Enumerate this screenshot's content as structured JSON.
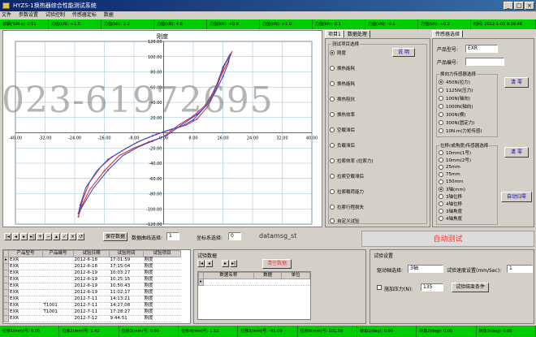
{
  "window": {
    "title": "HYZS-1换热器综合性能测试系统",
    "buttons": [
      "_",
      "□",
      "×"
    ]
  },
  "menu": [
    "文件",
    "参数设置",
    "试验控制",
    "传感器定标",
    "数据"
  ],
  "readings": [
    "日期(%M·s): 0.51",
    "力值(kN): +1.5",
    "力值(kN): 2.2",
    "力值(kN): 4.6",
    "力值(kN): +0.6",
    "力值(kN): +1.0",
    "力值(kN): 0.1",
    "力值(kN): -0.1",
    "力值(kN): +0.2",
    "时间: 2012-1-03 9:36:46"
  ],
  "chart": {
    "title": "刚度",
    "x_ticks": [
      "-40.00",
      "-32.00",
      "-24.00",
      "-16.00",
      "-8.00",
      "0.00",
      "8.00",
      "16.00",
      "24.00",
      "32.00",
      "40.00"
    ],
    "y_ticks": [
      "120.00",
      "100.00",
      "80.00",
      "60.00",
      "40.00",
      "20.00",
      "0.00",
      "-20.00",
      "-40.00",
      "-60.00",
      "-80.00",
      "-100.00",
      "-120.00"
    ]
  },
  "chart_data": {
    "type": "line",
    "title": "刚度",
    "xlim": [
      -40,
      40
    ],
    "ylim": [
      -120,
      120
    ],
    "grid": true,
    "series": [
      {
        "color": "#e03030",
        "points": [
          [
            -23.0,
            -110.0
          ],
          [
            -22.0,
            -95.0
          ],
          [
            -20.0,
            -75.0
          ],
          [
            -16.0,
            -50.0
          ],
          [
            -12.0,
            -30.0
          ],
          [
            -8.0,
            -20.0
          ],
          [
            -4.0,
            -12.0
          ],
          [
            0.0,
            -5.0
          ],
          [
            4.0,
            10.0
          ],
          [
            8.0,
            22.0
          ],
          [
            11.0,
            35.0
          ],
          [
            13.0,
            50.0
          ],
          [
            15.0,
            70.0
          ],
          [
            17.0,
            90.0
          ],
          [
            18.5,
            107.0
          ],
          [
            16.5,
            90.0
          ],
          [
            14.0,
            55.0
          ],
          [
            12.0,
            35.0
          ],
          [
            9.0,
            18.0
          ],
          [
            6.0,
            10.0
          ],
          [
            2.0,
            4.0
          ],
          [
            -2.0,
            -2.0
          ],
          [
            -6.0,
            -10.0
          ],
          [
            -10.0,
            -20.0
          ],
          [
            -14.0,
            -32.0
          ],
          [
            -17.0,
            -45.0
          ],
          [
            -20.0,
            -65.0
          ],
          [
            -22.0,
            -90.0
          ],
          [
            -23.0,
            -110.0
          ]
        ]
      },
      {
        "color": "#3050d0",
        "points": [
          [
            -23.0,
            -106.0
          ],
          [
            -21.5,
            -93.0
          ],
          [
            -19.0,
            -73.0
          ],
          [
            -15.0,
            -49.0
          ],
          [
            -11.0,
            -30.0
          ],
          [
            -7.0,
            -19.0
          ],
          [
            -3.0,
            -11.0
          ],
          [
            1.0,
            -3.0
          ],
          [
            5.0,
            11.0
          ],
          [
            9.0,
            24.0
          ],
          [
            12.0,
            38.0
          ],
          [
            14.0,
            54.0
          ],
          [
            16.0,
            74.0
          ],
          [
            17.5,
            92.0
          ],
          [
            18.0,
            104.0
          ],
          [
            16.0,
            86.0
          ],
          [
            13.5,
            52.0
          ],
          [
            11.0,
            33.0
          ],
          [
            8.0,
            17.0
          ],
          [
            5.0,
            9.0
          ],
          [
            1.0,
            3.0
          ],
          [
            -3.0,
            -4.0
          ],
          [
            -7.0,
            -12.0
          ],
          [
            -11.0,
            -23.0
          ],
          [
            -15.0,
            -35.0
          ],
          [
            -18.0,
            -50.0
          ],
          [
            -21.0,
            -72.0
          ],
          [
            -22.5,
            -95.0
          ],
          [
            -23.0,
            -106.0
          ]
        ]
      }
    ]
  },
  "tabs": {
    "tab1": "项目1",
    "tab2": "数据处理",
    "tab3": "传感器选择"
  },
  "test_options": {
    "caption": "测试项目选择",
    "items": [
      "刚度",
      "换热能耗",
      "换热能耗",
      "换热阻抗",
      "换热效率",
      "空载滞后",
      "负载滞后",
      "拉索效率 (拉索力)",
      "拉索空载滞后",
      "拉索载荷能力",
      "拉索行程损失",
      "自定义试验"
    ],
    "selected": 0,
    "button": "说 明"
  },
  "sensor": {
    "product_no_label": "产品型号:",
    "product_no_value": "EXR",
    "product_name_label": "产品编号:",
    "product_name_value": "",
    "force_caption": "换向力传感器选择",
    "force_items": [
      "450N(拉力)",
      "1125N(压力)",
      "100N(轴向)",
      "1000N(轴向)",
      "300N(横)",
      "300N(固定力)",
      "10N.m(力矩传感)"
    ],
    "force_selected": 0,
    "clear1": "清 零",
    "disp_caption": "位移(或角度)传感器选择",
    "disp_items": [
      "10mm(1号)",
      "10mm(2号)",
      "25mm",
      "75mm",
      "150mm",
      "3轴(mm)",
      "3轴位移",
      "4轴位移",
      "3轴角度",
      "4轴角度"
    ],
    "disp_selected": 5,
    "clear2": "清 零",
    "auto_zero": "自动归零"
  },
  "toolbar": {
    "nav_glyphs": [
      "|◂",
      "◂",
      "▸",
      "▸|",
      "+",
      "−",
      "▴",
      "✓",
      "×",
      "↺"
    ],
    "save": "保存数据",
    "data_curve_label": "数据曲线选择:",
    "data_curve_value": "1",
    "coord_label": "坐标系选择:",
    "coord_value": "0",
    "file_name": "datamsg_st"
  },
  "auto_test": "自动测试",
  "records": {
    "columns": [
      "产品型号",
      "产品编号",
      "试验日期",
      "试验时间",
      "试验项目"
    ],
    "rows": [
      [
        "EXR",
        "",
        "2012-6-18",
        "17:01:59",
        "刚度"
      ],
      [
        "EXR",
        "",
        "2012-6-18",
        "17:15:04",
        "刚度"
      ],
      [
        "EXR",
        "",
        "2012-6-19",
        "10:03:27",
        "刚度"
      ],
      [
        "EXR",
        "",
        "2012-6-19",
        "10:25:15",
        "刚度"
      ],
      [
        "EXR",
        "",
        "2012-6-19",
        "10:50:43",
        "刚度"
      ],
      [
        "EXR",
        "",
        "2012-6-19",
        "11:02:17",
        "刚度"
      ],
      [
        "EXR",
        "",
        "2012-7-11",
        "14:13:21",
        "刚度"
      ],
      [
        "EXR",
        "T1001",
        "2012-7-11",
        "14:27:08",
        "刚度"
      ],
      [
        "EXR",
        "T1001",
        "2012-7-11",
        "17:28:27",
        "刚度"
      ],
      [
        "EXR",
        "",
        "2012-7-12",
        "9:44:51",
        "刚度"
      ]
    ]
  },
  "test_data": {
    "caption": "试验数据",
    "clear": "清空数据",
    "columns": [
      "数据名称",
      "数据",
      "单位"
    ]
  },
  "test_settings": {
    "caption": "试验设置",
    "axis_label": "驱动轴选择:",
    "axis_value": "3轴",
    "speed_label": "试验速度设置(mm/Sec):",
    "speed_value": "1",
    "load_label": "施加压力(N):",
    "load_value": "135",
    "end_button": "试验结束条件"
  },
  "status": [
    "位移1(mm)号: 0.05",
    "位移2(mm)号: 2.42",
    "位移3(mm)号: 0.00",
    "位移4(mm)号: 1.52",
    "位移5(mm)号: -95.09",
    "位移6(mm)号: 101.59",
    "转角1(deg): 0.00",
    "转角2(deg): 0.00",
    "转角3(deg): 0.00"
  ],
  "watermark": "023-61972695"
}
